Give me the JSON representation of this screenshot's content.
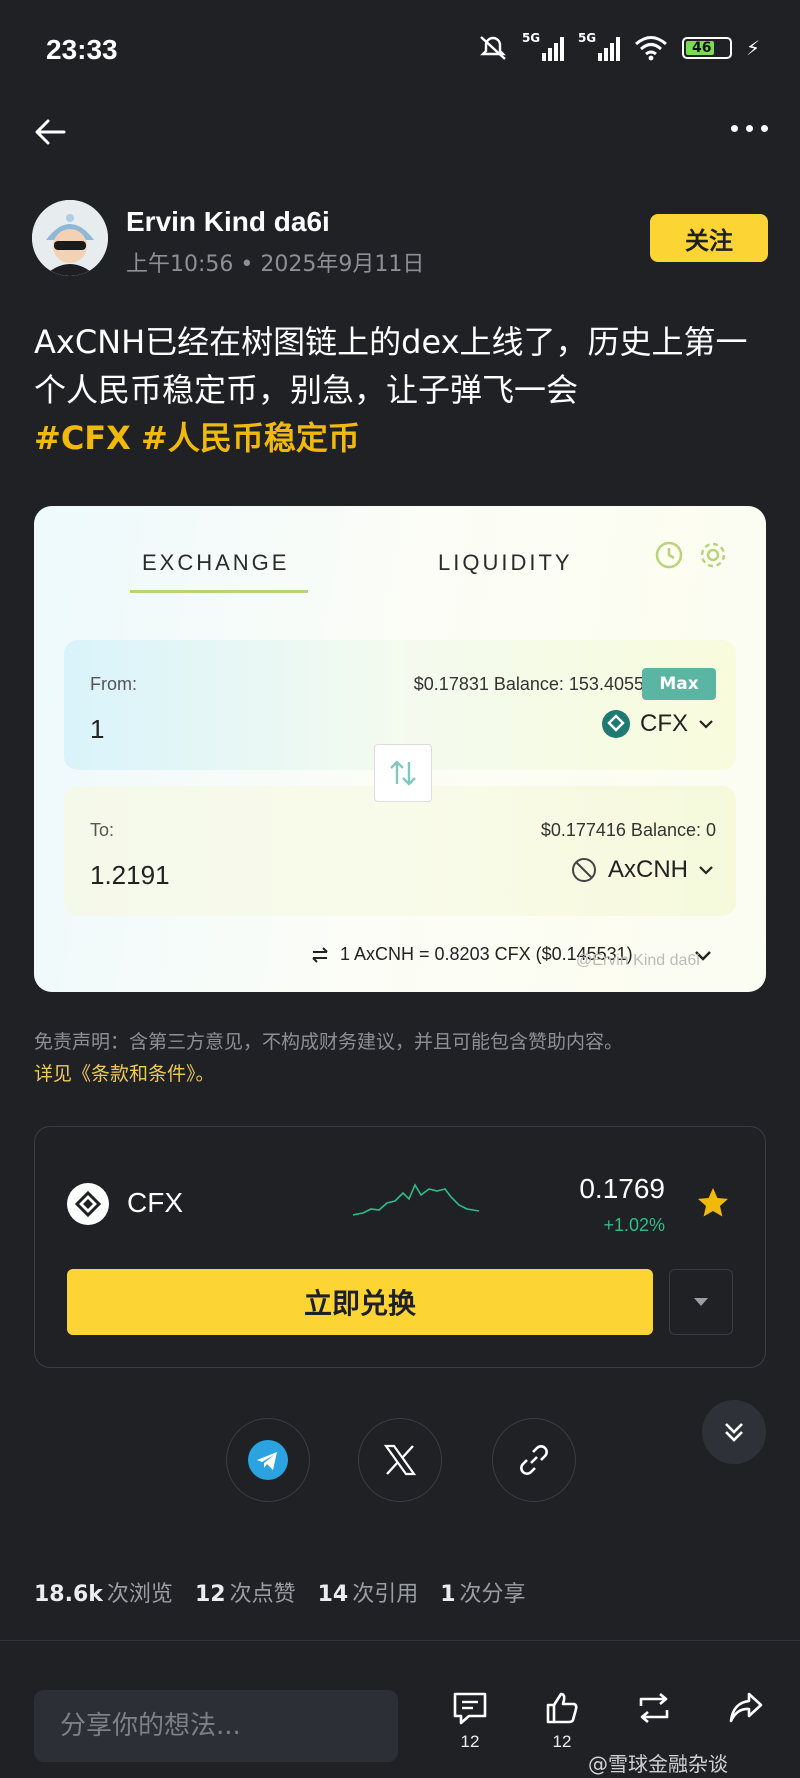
{
  "status_bar": {
    "time": "23:33",
    "net1": "5G",
    "net2": "5G",
    "battery": "46"
  },
  "author": {
    "name": "Ervin Kind da6i",
    "time": "上午10:56",
    "date": "2025年9月11日",
    "follow_label": "关注"
  },
  "post": {
    "text": "AxCNH已经在树图链上的dex上线了，历史上第一个人民币稳定币，别急，让子弹飞一会",
    "hashtags": [
      "#CFX",
      "#人民币稳定币"
    ]
  },
  "swap_widget": {
    "tabs": [
      "EXCHANGE",
      "LIQUIDITY"
    ],
    "from_label": "From:",
    "from_amount": "1",
    "from_balance": "$0.17831 Balance: 153.40552",
    "max_label": "Max",
    "from_token": "CFX",
    "to_label": "To:",
    "to_amount": "1.2191",
    "to_balance": "$0.177416 Balance: 0",
    "to_token": "AxCNH",
    "rate": "1 AxCNH = 0.8203 CFX ($0.145531)",
    "watermark": "@Ervin Kind da6i"
  },
  "disclaimer": {
    "text": "免责声明：含第三方意见，不构成财务建议，并且可能包含赞助内容。",
    "terms": "详见《条款和条件》。"
  },
  "token_card": {
    "name": "CFX",
    "price": "0.1769",
    "change": "+1.02%",
    "swap_label": "立即兑换"
  },
  "stats": [
    {
      "value": "18.6k",
      "label": "次浏览"
    },
    {
      "value": "12",
      "label": "次点赞"
    },
    {
      "value": "14",
      "label": "次引用"
    },
    {
      "value": "1",
      "label": "次分享"
    }
  ],
  "bottom_bar": {
    "placeholder": "分享你的想法...",
    "comment_count": "12",
    "like_count": "12",
    "watermark": "@雪球金融杂谈"
  },
  "colors": {
    "accent": "#fcd535",
    "positive": "#2ebd85",
    "background": "#1f2125"
  }
}
